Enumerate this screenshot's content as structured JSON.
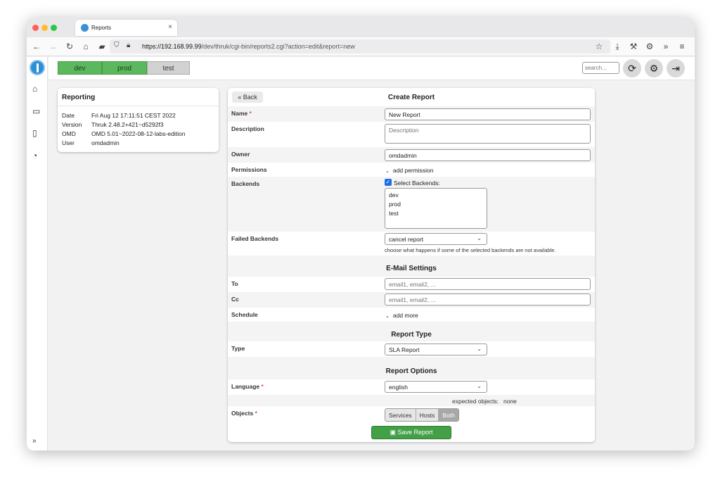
{
  "browser": {
    "tab_title": "Reports",
    "tab_close": "×",
    "url_host": "https://192.168.99.99",
    "url_path": "/dev/thruk/cgi-bin/reports2.cgi?action=edit&report=new"
  },
  "topbar": {
    "backends": [
      "dev",
      "prod",
      "test"
    ],
    "search_placeholder": "search..."
  },
  "reporting": {
    "title": "Reporting",
    "rows": [
      {
        "k": "Date",
        "v": "Fri Aug 12 17:11:51 CEST 2022"
      },
      {
        "k": "Version",
        "v": "Thruk 2.48.2+421~d5292f3"
      },
      {
        "k": "OMD",
        "v": "OMD 5.01~2022-08-12-labs-edition"
      },
      {
        "k": "User",
        "v": "omdadmin"
      }
    ]
  },
  "form": {
    "back": "Back",
    "title": "Create Report",
    "name_label": "Name",
    "name_value": "New Report",
    "description_label": "Description",
    "description_placeholder": "Description",
    "owner_label": "Owner",
    "owner_value": "omdadmin",
    "permissions_label": "Permissions",
    "add_permission": "add permission",
    "backends_label": "Backends",
    "select_backends": "Select Backends:",
    "backend_options": [
      "dev",
      "prod",
      "test"
    ],
    "failed_label": "Failed Backends",
    "failed_value": "cancel report",
    "failed_hint": "choose what happens if some of the selected backends are not available.",
    "email_title": "E-Mail Settings",
    "to_label": "To",
    "to_placeholder": "email1, email2, ...",
    "cc_label": "Cc",
    "cc_placeholder": "email1, email2, ...",
    "schedule_label": "Schedule",
    "add_more": "add more",
    "type_title": "Report Type",
    "type_label": "Type",
    "type_value": "SLA Report",
    "options_title": "Report Options",
    "language_label": "Language",
    "language_value": "english",
    "expected_label": "expected objects:",
    "expected_value": "none",
    "objects_label": "Objects",
    "objects_options": [
      "Services",
      "Hosts",
      "Both"
    ],
    "objects_selected": "Both",
    "save": "Save Report"
  }
}
